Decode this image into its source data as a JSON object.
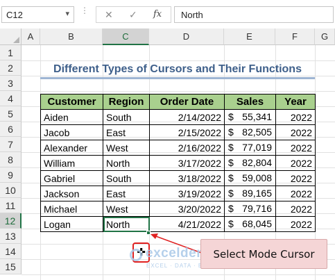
{
  "formula_bar": {
    "name_box": "C12",
    "cancel_icon": "✕",
    "enter_icon": "✓",
    "fx_label": "fx",
    "formula": "North"
  },
  "grid": {
    "columns": [
      "A",
      "B",
      "C",
      "D",
      "E",
      "F",
      "G"
    ],
    "selected_column": "C",
    "rows": [
      "1",
      "2",
      "3",
      "4",
      "5",
      "6",
      "7",
      "8",
      "9",
      "10",
      "11",
      "12",
      "13",
      "14",
      "15"
    ],
    "selected_row": "12"
  },
  "sheet": {
    "title": "Different Types of Cursors and Their Functions",
    "headers": [
      "Customer",
      "Region",
      "Order Date",
      "Sales",
      "Year"
    ],
    "rows": [
      {
        "customer": "Aiden",
        "region": "South",
        "date": "2/14/2022",
        "currency": "$",
        "sales": "55,341",
        "year": "2022"
      },
      {
        "customer": "Jacob",
        "region": "East",
        "date": "2/15/2022",
        "currency": "$",
        "sales": "82,505",
        "year": "2022"
      },
      {
        "customer": "Alexander",
        "region": "West",
        "date": "2/16/2022",
        "currency": "$",
        "sales": "77,019",
        "year": "2022"
      },
      {
        "customer": "William",
        "region": "North",
        "date": "3/17/2022",
        "currency": "$",
        "sales": "82,804",
        "year": "2022"
      },
      {
        "customer": "Gabriel",
        "region": "South",
        "date": "3/18/2022",
        "currency": "$",
        "sales": "59,008",
        "year": "2022"
      },
      {
        "customer": "Jackson",
        "region": "East",
        "date": "3/19/2022",
        "currency": "$",
        "sales": "89,165",
        "year": "2022"
      },
      {
        "customer": "Michael",
        "region": "West",
        "date": "3/20/2022",
        "currency": "$",
        "sales": "79,716",
        "year": "2022"
      },
      {
        "customer": "Logan",
        "region": "North",
        "date": "4/21/2022",
        "currency": "$",
        "sales": "68,045",
        "year": "2022"
      }
    ]
  },
  "annotation": {
    "cursor_icon": "select-mode-cursor",
    "cursor_glyph": "✜",
    "callout": "Select Mode Cursor",
    "highlight_color": "#e02020"
  },
  "watermark": {
    "name": "exceldemy",
    "tagline": "EXCEL · DATA · BI"
  },
  "colors": {
    "header_fill": "#a9d08e",
    "title_color": "#3e5f8a",
    "selection_green": "#217346"
  }
}
